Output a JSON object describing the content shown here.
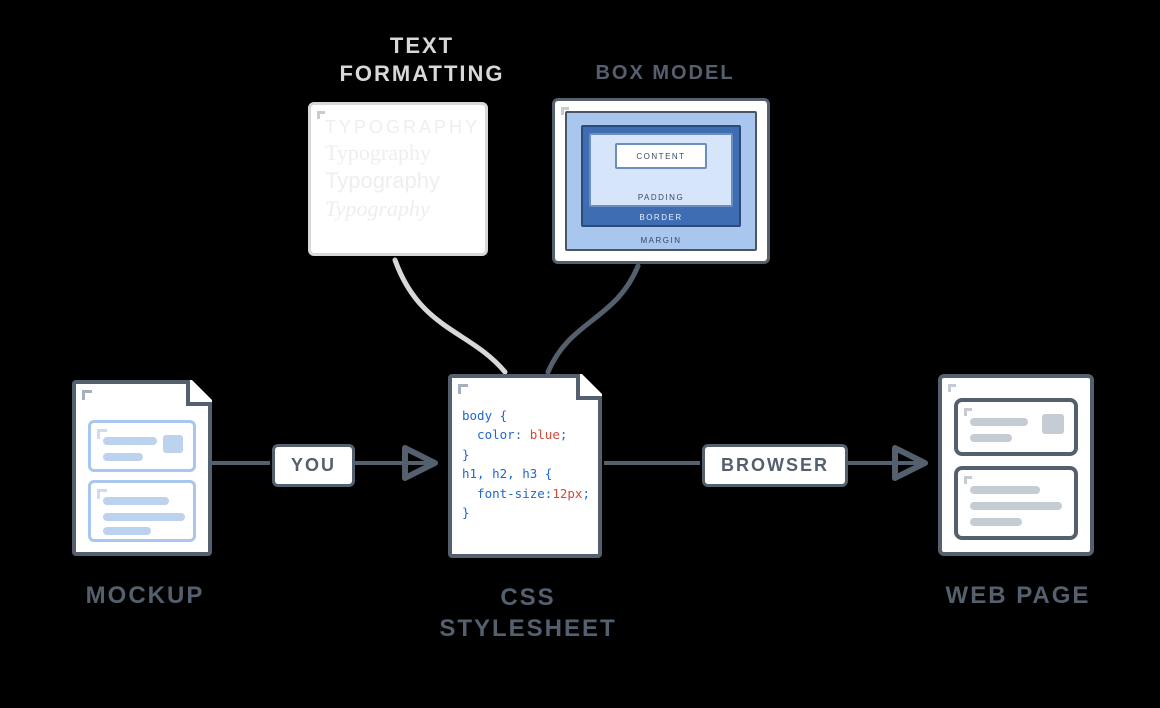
{
  "headings": {
    "text_formatting_l1": "TEXT",
    "text_formatting_l2": "FORMATTING",
    "box_model": "BOX MODEL",
    "mockup": "MOCKUP",
    "css_l1": "CSS",
    "css_l2": "STYLESHEET",
    "web_page": "WEB PAGE"
  },
  "labels": {
    "you": "YOU",
    "browser": "BROWSER"
  },
  "typography_panel": {
    "lines": [
      "TYPOGRAPHY",
      "Typography",
      "Typography",
      "Typography"
    ]
  },
  "box_model_panel": {
    "content": "CONTENT",
    "padding": "PADDING",
    "border": "BORDER",
    "margin": "MARGIN"
  },
  "css_code": {
    "l1_sel": "body",
    "l1_open": " {",
    "l2_prop": "  color",
    "l2_val": "blue",
    "l3_close": "}",
    "l4_sel": "h1, h2, h3",
    "l4_open": " {",
    "l5_prop": "  font-size",
    "l5_val": "12px",
    "l6_close": "}"
  },
  "colors": {
    "ink": "#55606e",
    "light": "#d8d8d8",
    "blue_fill": "#a9c6ee",
    "blue_deep": "#3f6db3"
  }
}
